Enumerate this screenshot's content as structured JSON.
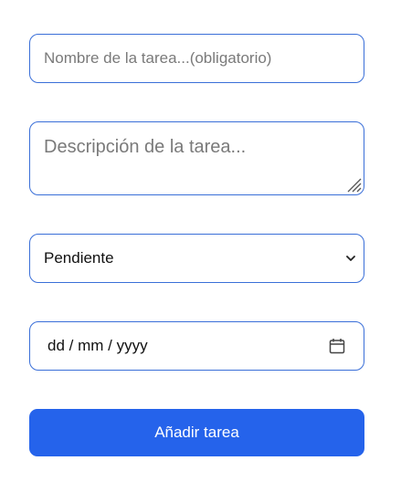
{
  "form": {
    "task_name": {
      "placeholder": "Nombre de la tarea...(obligatorio)",
      "value": ""
    },
    "task_description": {
      "placeholder": "Descripción de la tarea...",
      "value": ""
    },
    "status_select": {
      "selected": "Pendiente",
      "icon": "chevron-down-icon"
    },
    "due_date": {
      "placeholder": "dd / mm / yyyy",
      "icon": "calendar-icon"
    },
    "submit_label": "Añadir tarea"
  },
  "colors": {
    "border": "#3a6fd8",
    "button": "#2563eb",
    "button_text": "#ffffff",
    "placeholder": "#7a7a7a"
  }
}
